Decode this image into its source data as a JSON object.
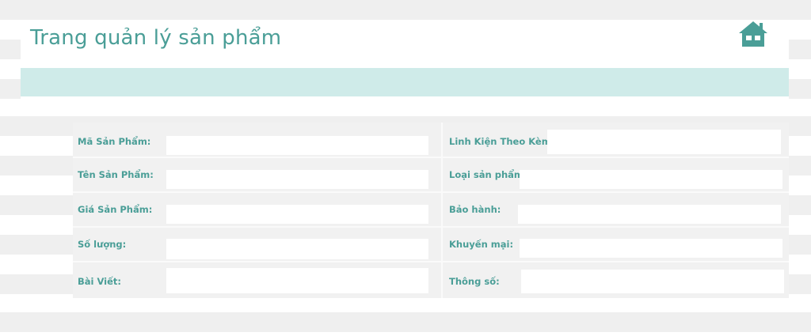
{
  "header": {
    "title": "Trang quản lý sản phẩm",
    "home_icon": "home-icon",
    "accent_color": "#4a9e97",
    "banner_color": "#cfebe9"
  },
  "form": {
    "left_fields": [
      {
        "label": "Mã Sản Phẩm:",
        "value": ""
      },
      {
        "label": "Tên Sản Phẩm:",
        "value": ""
      },
      {
        "label": "Giá Sản Phẩm:",
        "value": ""
      },
      {
        "label": "Số lượng:",
        "value": ""
      },
      {
        "label": "Bài Viết:",
        "value": ""
      }
    ],
    "right_fields": [
      {
        "label": "Linh Kiện Theo Kèm:",
        "value": ""
      },
      {
        "label": "Loại sản phẩm:",
        "value": ""
      },
      {
        "label": "Bảo hành:",
        "value": ""
      },
      {
        "label": "Khuyến mại:",
        "value": ""
      },
      {
        "label": "Thông số:",
        "value": ""
      }
    ]
  }
}
